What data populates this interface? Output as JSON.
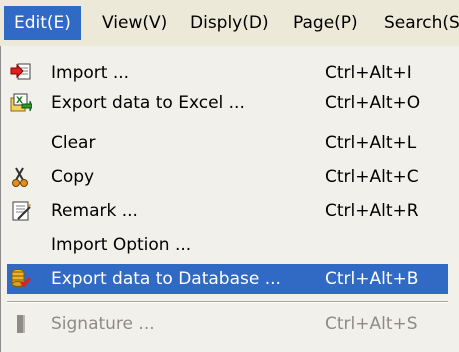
{
  "menubar": {
    "items": [
      {
        "label": "Edit(E)"
      },
      {
        "label": "View(V)"
      },
      {
        "label": "Disply(D)"
      },
      {
        "label": "Page(P)"
      },
      {
        "label": "Search(S"
      }
    ]
  },
  "edit_menu": {
    "items": [
      {
        "label": "Import ...",
        "shortcut": "Ctrl+Alt+I",
        "icon": "import-icon"
      },
      {
        "label": "Export data to Excel ...",
        "shortcut": "Ctrl+Alt+O",
        "icon": "excel-export-icon"
      },
      {
        "label": "Clear",
        "shortcut": "Ctrl+Alt+L",
        "icon": ""
      },
      {
        "label": "Copy",
        "shortcut": "Ctrl+Alt+C",
        "icon": "scissors-icon"
      },
      {
        "label": "Remark ...",
        "shortcut": "Ctrl+Alt+R",
        "icon": "remark-icon"
      },
      {
        "label": "Import Option ...",
        "shortcut": "",
        "icon": ""
      },
      {
        "label": "Export data to Database ...",
        "shortcut": "Ctrl+Alt+B",
        "icon": "database-export-icon",
        "state": "highlighted"
      },
      {
        "label": "Signature ...",
        "shortcut": "Ctrl+Alt+S",
        "icon": "signature-icon",
        "state": "disabled"
      }
    ]
  },
  "colors": {
    "highlight": "#316ac5",
    "menu_background": "#f2f0ea",
    "disabled_text": "#8e8b86"
  }
}
